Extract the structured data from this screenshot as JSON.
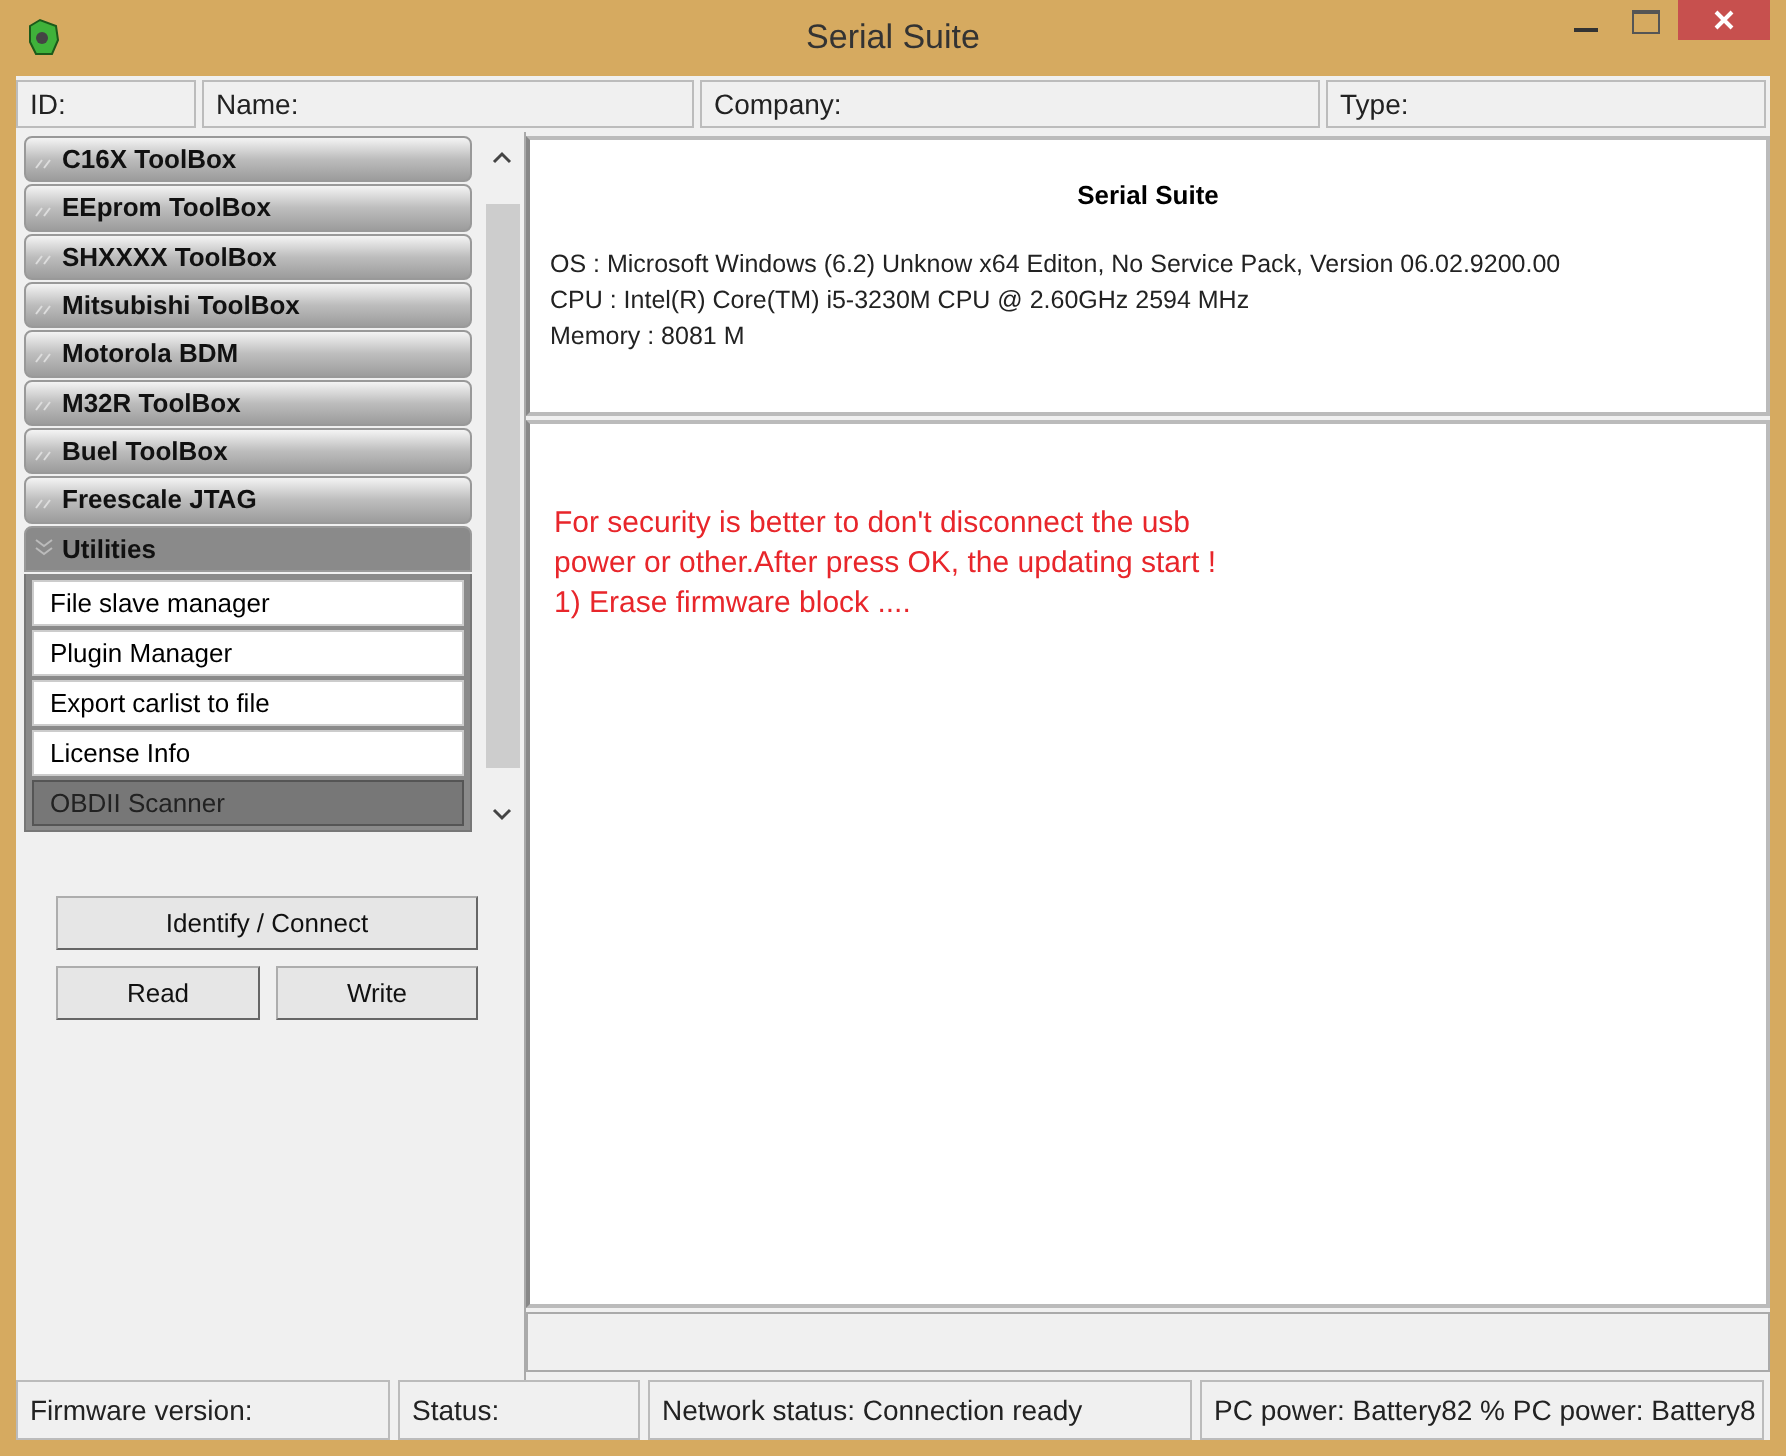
{
  "window": {
    "title": "Serial Suite"
  },
  "header_fields": [
    {
      "label": "ID:"
    },
    {
      "label": "Name:"
    },
    {
      "label": "Company:"
    },
    {
      "label": "Type:"
    }
  ],
  "sidebar": {
    "groups": [
      {
        "label": "C16X ToolBox",
        "expanded": false
      },
      {
        "label": "EEprom ToolBox",
        "expanded": false
      },
      {
        "label": "SHXXXX ToolBox",
        "expanded": false
      },
      {
        "label": "Mitsubishi ToolBox",
        "expanded": false
      },
      {
        "label": "Motorola BDM",
        "expanded": false
      },
      {
        "label": "M32R ToolBox",
        "expanded": false
      },
      {
        "label": "Buel ToolBox",
        "expanded": false
      },
      {
        "label": "Freescale JTAG",
        "expanded": false
      },
      {
        "label": "Utilities",
        "expanded": true,
        "items": [
          {
            "label": "File slave manager",
            "selected": false
          },
          {
            "label": "Plugin Manager",
            "selected": false
          },
          {
            "label": "Export carlist to file",
            "selected": false
          },
          {
            "label": "License Info",
            "selected": false
          },
          {
            "label": "OBDII Scanner",
            "selected": true
          }
        ]
      }
    ]
  },
  "buttons": {
    "identify": "Identify / Connect",
    "read": "Read",
    "write": "Write"
  },
  "info": {
    "title": "Serial Suite",
    "lines": [
      "OS : Microsoft Windows (6.2) Unknow x64 Editon, No Service Pack, Version 06.02.9200.00",
      "CPU : Intel(R) Core(TM) i5-3230M CPU @ 2.60GHz 2594 MHz",
      "Memory : 8081 M"
    ]
  },
  "message": [
    "For security is better to don't disconnect the usb",
    "power or other.After press OK, the updating start !",
    "1) Erase firmware block ...."
  ],
  "status_bar": [
    "Firmware version:",
    "Status:",
    "Network status: Connection ready",
    "PC power: Battery82 % PC power: Battery8"
  ]
}
